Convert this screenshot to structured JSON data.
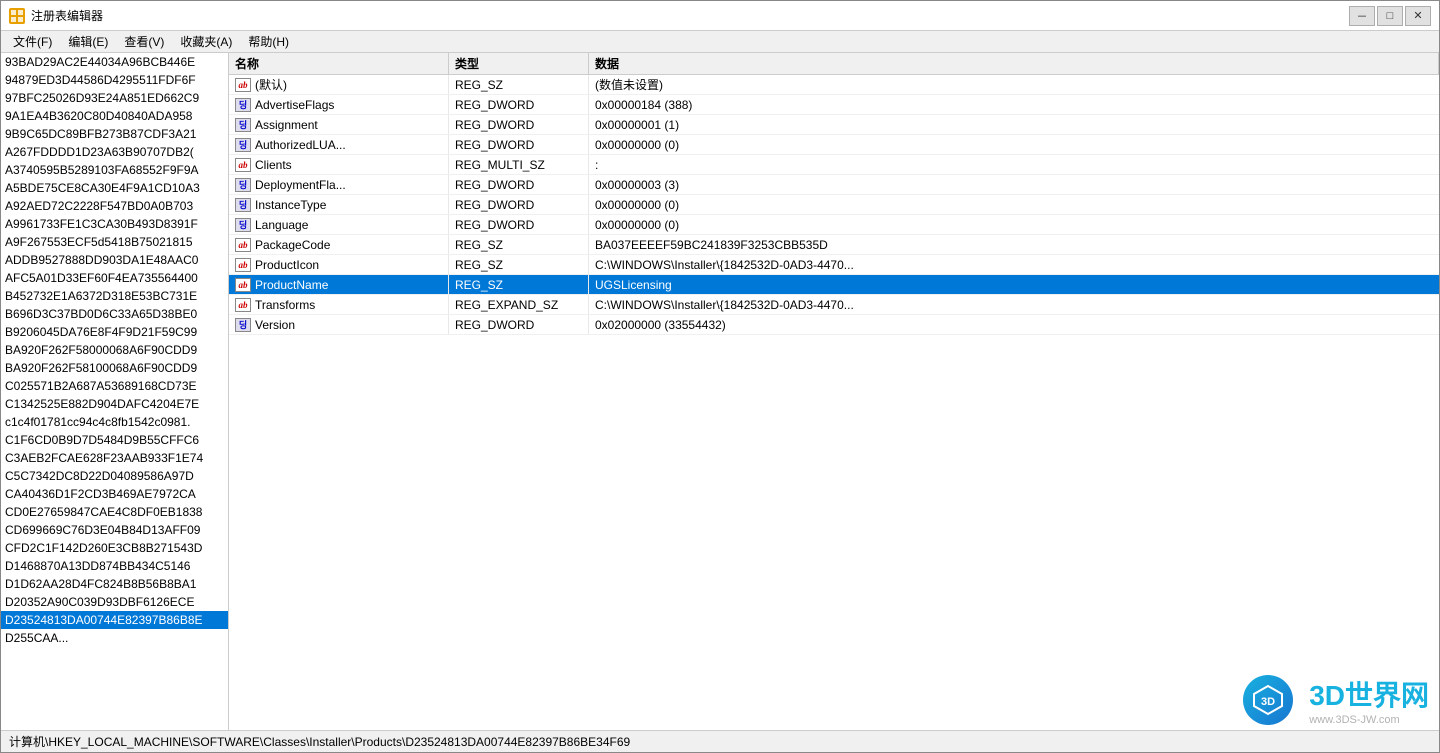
{
  "window": {
    "title": "注册表编辑器",
    "controls": {
      "minimize": "－",
      "maximize": "□",
      "close": "✕"
    }
  },
  "menu": {
    "items": [
      {
        "label": "文件(F)"
      },
      {
        "label": "编辑(E)"
      },
      {
        "label": "查看(V)"
      },
      {
        "label": "收藏夹(A)"
      },
      {
        "label": "帮助(H)"
      }
    ]
  },
  "left_panel": {
    "items": [
      "93BAD29AC2E44034A96BCB446E",
      "94879ED3D44586D4295511FDF6F",
      "97BFC25026D93E24A851ED662C9",
      "9A1EA4B3620C80D40840ADA958",
      "9B9C65DC89BFB273B87CDF3A21",
      "A267FDDDD1D23A63B90707DB2",
      "A3740595B5289103FA68552F9F9A",
      "A5BDE75CE8CA30E4F9A1CD10A3",
      "A92AED72C2228F547BD0A0B703",
      "A9961733FE1C3CA30B493D8391F",
      "A9F267553ECF5d5418B75021815",
      "ADDB9527888DD903DA1E48AAC0",
      "AFC5A01D33EF60F4EA735564400",
      "B452732E1A6372D318E53BC731E",
      "B696D3C37BD0D6C33A65D38BE0",
      "B9206045DA76E8F4F9D21F59C99",
      "BA920F262F58000068A6F90CDD9",
      "BA920F262F58100068A6F90CDD9",
      "C025571B2A687A53689168CD73E",
      "C1342525E882D904DAFC4204E7E",
      "c1c4f01781cc94c4c8fb1542c0981",
      "C1F6CD0B9D7D5484D9B55CFFC6",
      "C3AEB2FCAE628F23AAB933F1E74",
      "C5C7342DC8D22D04089586A97D",
      "CA40436D1F2CD3B469AE7972CA",
      "CD0E27659847CAE4C8DF0EB1838",
      "CD699669C76D3E04B84D13AFF09",
      "CFD2C1F142D260E3CB8B271543D",
      "D1468870A13DD874BB434C5146",
      "D1D62AA28D4FC824B8B56B8BA1",
      "D20352A90C039D93DBF6126ECE",
      "D23524813DA00744E82397B86B8",
      "D255CAA..."
    ]
  },
  "table": {
    "headers": {
      "name": "名称",
      "type": "类型",
      "data": "数据"
    },
    "rows": [
      {
        "icon": "ab",
        "name": "(默认)",
        "type": "REG_SZ",
        "data": "(数值未设置)"
      },
      {
        "icon": "dword",
        "name": "AdvertiseFlags",
        "type": "REG_DWORD",
        "data": "0x00000184 (388)"
      },
      {
        "icon": "dword",
        "name": "Assignment",
        "type": "REG_DWORD",
        "data": "0x00000001 (1)"
      },
      {
        "icon": "dword",
        "name": "AuthorizedLUA...",
        "type": "REG_DWORD",
        "data": "0x00000000 (0)"
      },
      {
        "icon": "ab",
        "name": "Clients",
        "type": "REG_MULTI_SZ",
        "data": ":"
      },
      {
        "icon": "dword",
        "name": "DeploymentFla...",
        "type": "REG_DWORD",
        "data": "0x00000003 (3)"
      },
      {
        "icon": "dword",
        "name": "InstanceType",
        "type": "REG_DWORD",
        "data": "0x00000000 (0)"
      },
      {
        "icon": "dword",
        "name": "Language",
        "type": "REG_DWORD",
        "data": "0x00000000 (0)"
      },
      {
        "icon": "ab",
        "name": "PackageCode",
        "type": "REG_SZ",
        "data": "BA037EEEEF59BC241839F3253CBB535D"
      },
      {
        "icon": "ab",
        "name": "ProductIcon",
        "type": "REG_SZ",
        "data": "C:\\WINDOWS\\Installer\\{1842532D-0AD3-4470..."
      },
      {
        "icon": "ab",
        "name": "ProductName",
        "type": "REG_SZ",
        "data": "UGSLicensing",
        "selected": true
      },
      {
        "icon": "ab",
        "name": "Transforms",
        "type": "REG_EXPAND_SZ",
        "data": "C:\\WINDOWS\\Installer\\{1842532D-0AD3-4470..."
      },
      {
        "icon": "dword",
        "name": "Version",
        "type": "REG_DWORD",
        "data": "0x02000000 (33554432)"
      }
    ]
  },
  "status_bar": {
    "text": "计算机\\HKEY_LOCAL_MACHINE\\SOFTWARE\\Classes\\Installer\\Products\\D23524813DA00744E82397B86BE34F69"
  },
  "watermark": {
    "site": "3D世界网",
    "sub": "www.3DS-JW.com"
  }
}
